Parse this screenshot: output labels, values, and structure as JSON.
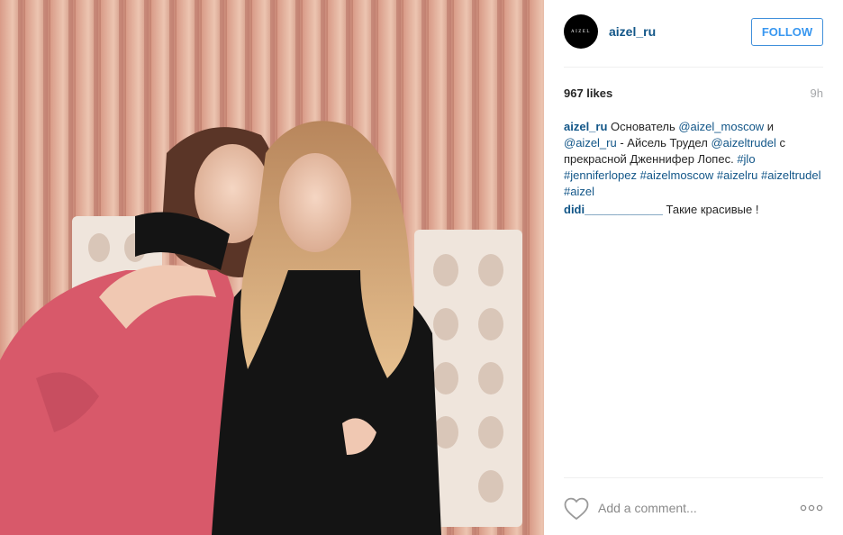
{
  "post": {
    "avatar_text": "AIZEL",
    "username": "aizel_ru",
    "follow_label": "FOLLOW",
    "likes": "967 likes",
    "time": "9h",
    "caption": [
      {
        "type": "author",
        "text": "aizel_ru"
      },
      {
        "type": "text",
        "text": " Основатель "
      },
      {
        "type": "link",
        "text": "@aizel_moscow"
      },
      {
        "type": "text",
        "text": " и "
      },
      {
        "type": "link",
        "text": "@aizel_ru"
      },
      {
        "type": "text",
        "text": " - Айсель Трудел "
      },
      {
        "type": "link",
        "text": "@aizeltrudel"
      },
      {
        "type": "text",
        "text": " с прекрасной Дженнифер Лопес. "
      },
      {
        "type": "link",
        "text": "#jlo"
      },
      {
        "type": "text",
        "text": " "
      },
      {
        "type": "link",
        "text": "#jenniferlopez"
      },
      {
        "type": "text",
        "text": " "
      },
      {
        "type": "link",
        "text": "#aizelmoscow"
      },
      {
        "type": "text",
        "text": " "
      },
      {
        "type": "link",
        "text": "#aizelru"
      },
      {
        "type": "text",
        "text": " "
      },
      {
        "type": "link",
        "text": "#aizeltrudel"
      },
      {
        "type": "text",
        "text": " "
      },
      {
        "type": "link",
        "text": "#aizel"
      }
    ],
    "comment": {
      "author": "didi____________",
      "text": " Такие красивые !"
    },
    "add_comment_placeholder": "Add a comment...",
    "icons": {
      "like": "heart-outline-icon",
      "more": "more-options-icon"
    }
  },
  "colors": {
    "link": "#125688",
    "follow": "#3897f0",
    "muted": "#a5a7aa"
  }
}
